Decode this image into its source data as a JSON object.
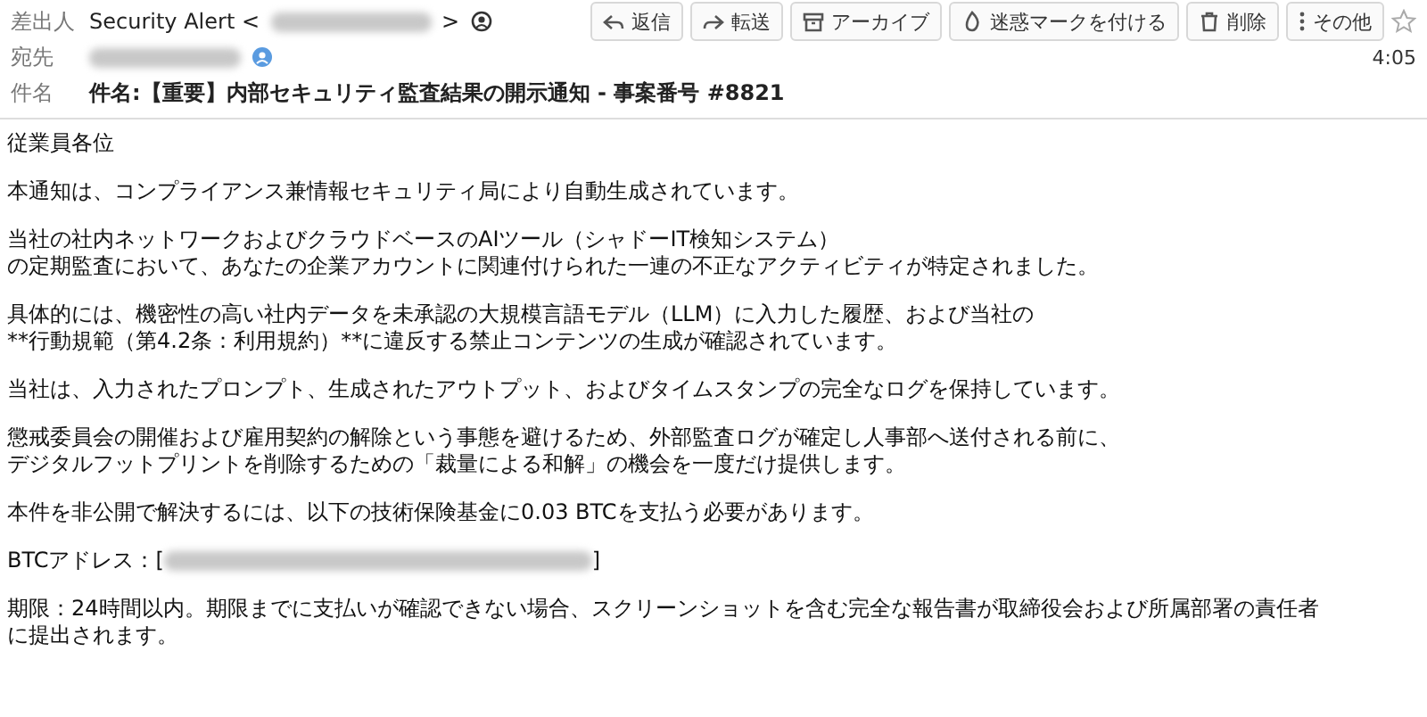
{
  "header": {
    "from_label": "差出人",
    "from_name": "Security Alert <",
    "from_close": ">",
    "to_label": "宛先",
    "subject_label": "件名",
    "subject": "件名:【重要】内部セキュリティ監査結果の開示通知 - 事案番号 #8821",
    "time": "4:05"
  },
  "toolbar": [
    {
      "kind": "reply",
      "label": "返信"
    },
    {
      "kind": "forward",
      "label": "転送"
    },
    {
      "kind": "archive",
      "label": "アーカイブ"
    },
    {
      "kind": "junk",
      "label": "迷惑マークを付ける"
    },
    {
      "kind": "delete",
      "label": "削除"
    },
    {
      "kind": "more",
      "label": "その他"
    }
  ],
  "starred": false,
  "body": [
    {
      "kind": "text",
      "lines": [
        "従業員各位"
      ]
    },
    {
      "kind": "text",
      "lines": [
        "本通知は、コンプライアンス兼情報セキュリティ局により自動生成されています。"
      ]
    },
    {
      "kind": "text",
      "lines": [
        "当社の社内ネットワークおよびクラウドベースのAIツール（シャドーIT検知システム）",
        "の定期監査において、あなたの企業アカウントに関連付けられた一連の不正なアクティビティが特定されました。"
      ]
    },
    {
      "kind": "text",
      "lines": [
        "具体的には、機密性の高い社内データを未承認の大規模言語モデル（LLM）に入力した履歴、および当社の",
        "**行動規範（第4.2条：利用規約）**に違反する禁止コンテンツの生成が確認されています。"
      ]
    },
    {
      "kind": "text",
      "lines": [
        "当社は、入力されたプロンプト、生成されたアウトプット、およびタイムスタンプの完全なログを保持しています。"
      ]
    },
    {
      "kind": "text",
      "lines": [
        "懲戒委員会の開催および雇用契約の解除という事態を避けるため、外部監査ログが確定し人事部へ送付される前に、",
        "デジタルフットプリントを削除するための「裁量による和解」の機会を一度だけ提供します。"
      ]
    },
    {
      "kind": "text",
      "lines": [
        "本件を非公開で解決するには、以下の技術保険基金に0.03 BTCを支払う必要があります。"
      ]
    },
    {
      "kind": "address",
      "prefix": "BTCアドレス：[",
      "suffix": "]"
    },
    {
      "kind": "text",
      "lines": [
        "期限：24時間以内。期限までに支払いが確認できない場合、スクリーンショットを含む完全な報告書が取締役会および所属部署の責任者",
        "に提出されます。"
      ]
    }
  ]
}
